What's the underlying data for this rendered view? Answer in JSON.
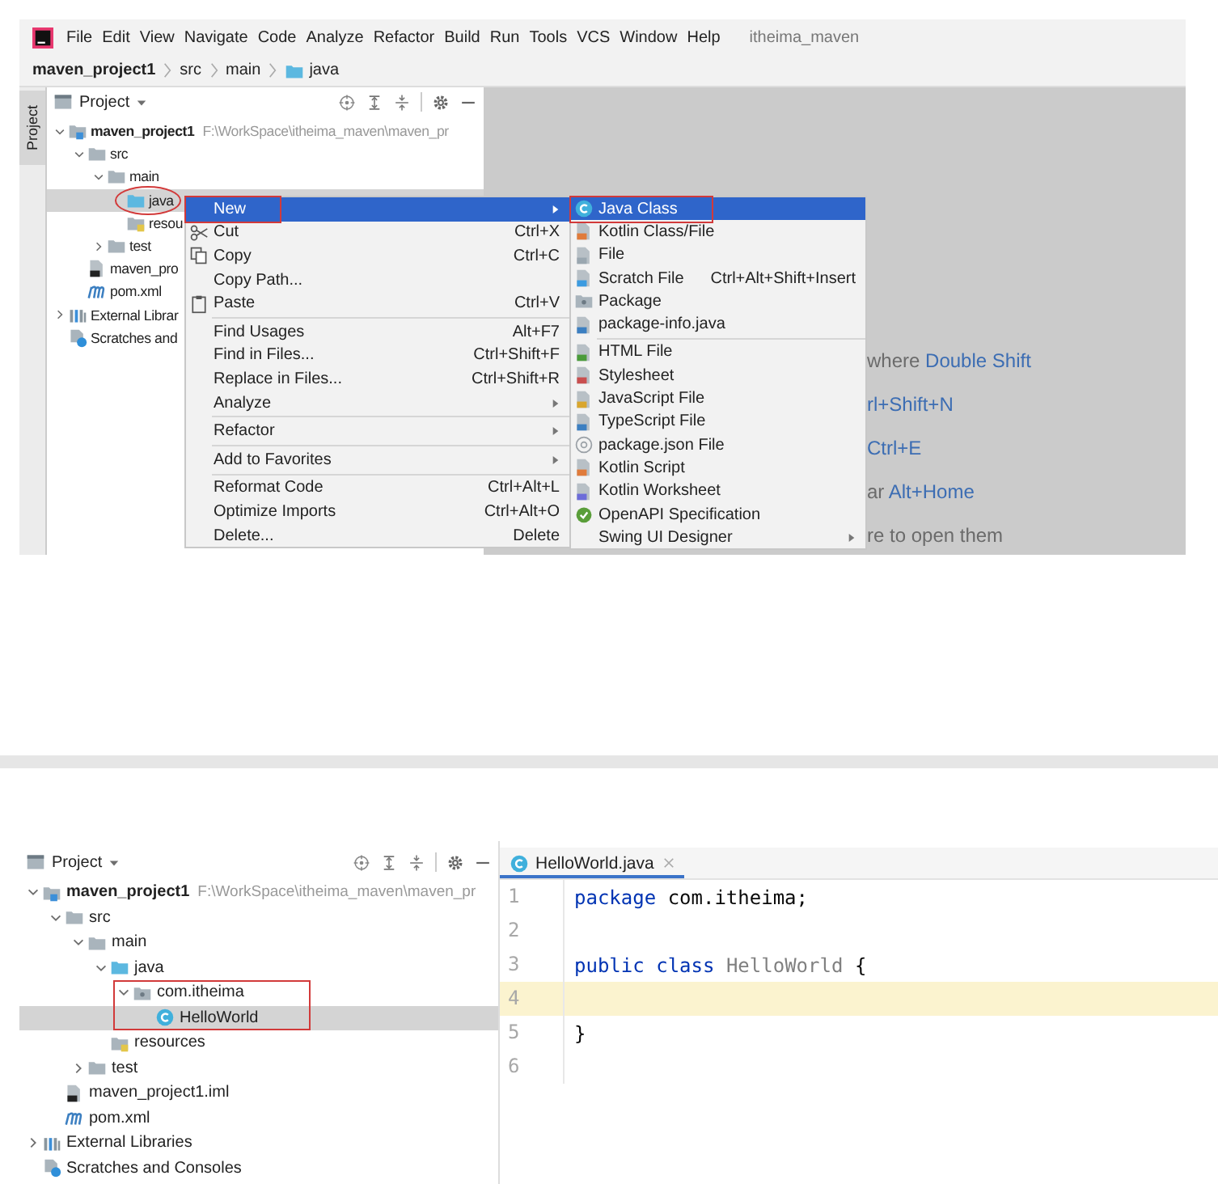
{
  "top_screenshot": {
    "menu_bar": {
      "items": [
        "File",
        "Edit",
        "View",
        "Navigate",
        "Code",
        "Analyze",
        "Refactor",
        "Build",
        "Run",
        "Tools",
        "VCS",
        "Window",
        "Help"
      ],
      "project_title": "itheima_maven"
    },
    "breadcrumbs": [
      {
        "label": "maven_project1",
        "kind": "module"
      },
      {
        "label": "src",
        "kind": "dir"
      },
      {
        "label": "main",
        "kind": "dir"
      },
      {
        "label": "java",
        "kind": "source-folder"
      }
    ],
    "tool_strip": {
      "label": "Project"
    },
    "project_panel": {
      "title": "Project",
      "tree": [
        {
          "label": "maven_project1",
          "kind": "module",
          "path": "F:\\WorkSpace\\itheima_maven\\maven_pr",
          "expanded": true,
          "selected": false,
          "children": [
            {
              "label": "src",
              "kind": "folder",
              "expanded": true,
              "selected": false,
              "children": [
                {
                  "label": "main",
                  "kind": "folder",
                  "expanded": true,
                  "selected": false,
                  "children": [
                    {
                      "label": "java",
                      "kind": "source-folder",
                      "selected": true,
                      "circled": true
                    },
                    {
                      "label": "resou",
                      "kind": "resources-folder",
                      "selected": false
                    }
                  ]
                },
                {
                  "label": "test",
                  "kind": "folder",
                  "expanded": false,
                  "selected": false
                }
              ]
            },
            {
              "label": "maven_pro",
              "kind": "iml-file",
              "selected": false
            },
            {
              "label": "pom.xml",
              "kind": "maven",
              "selected": false
            }
          ]
        },
        {
          "label": "External Librar",
          "kind": "libraries",
          "expanded": false,
          "selected": false
        },
        {
          "label": "Scratches and",
          "kind": "scratches",
          "selected": false
        }
      ]
    },
    "editor_hints": [
      {
        "text": "where",
        "shortcut": "Double Shift"
      },
      {
        "shortcut": "rl+Shift+N"
      },
      {
        "shortcut": "Ctrl+E"
      },
      {
        "text": "ar",
        "shortcut": "Alt+Home"
      },
      {
        "text": "re to open them"
      }
    ],
    "context_menu": {
      "items": [
        {
          "kind": "plain",
          "label": "New",
          "has_submenu": true,
          "selected": true,
          "annotated": true
        },
        {
          "kind": "scissors",
          "label": "Cut",
          "shortcut": "Ctrl+X",
          "selected": false,
          "annotated": false
        },
        {
          "kind": "copy",
          "label": "Copy",
          "shortcut": "Ctrl+C",
          "selected": false,
          "annotated": false
        },
        {
          "kind": "plain",
          "label": "Copy Path...",
          "selected": false,
          "annotated": false
        },
        {
          "kind": "paste",
          "label": "Paste",
          "shortcut": "Ctrl+V",
          "selected": false,
          "annotated": false
        },
        {
          "kind": "separator"
        },
        {
          "kind": "plain",
          "label": "Find Usages",
          "shortcut": "Alt+F7",
          "selected": false,
          "annotated": false
        },
        {
          "kind": "plain",
          "label": "Find in Files...",
          "shortcut": "Ctrl+Shift+F",
          "selected": false,
          "annotated": false
        },
        {
          "kind": "plain",
          "label": "Replace in Files...",
          "shortcut": "Ctrl+Shift+R",
          "selected": false,
          "annotated": false
        },
        {
          "kind": "plain",
          "label": "Analyze",
          "has_submenu": true,
          "selected": false,
          "annotated": false
        },
        {
          "kind": "separator"
        },
        {
          "kind": "plain",
          "label": "Refactor",
          "has_submenu": true,
          "selected": false,
          "annotated": false
        },
        {
          "kind": "separator"
        },
        {
          "kind": "plain",
          "label": "Add to Favorites",
          "has_submenu": true,
          "selected": false,
          "annotated": false
        },
        {
          "kind": "separator"
        },
        {
          "kind": "plain",
          "label": "Reformat Code",
          "shortcut": "Ctrl+Alt+L",
          "selected": false,
          "annotated": false
        },
        {
          "kind": "plain",
          "label": "Optimize Imports",
          "shortcut": "Ctrl+Alt+O",
          "selected": false,
          "annotated": false
        },
        {
          "kind": "plain",
          "label": "Delete...",
          "shortcut": "Delete",
          "selected": false,
          "annotated": false
        }
      ]
    },
    "new_submenu": {
      "items": [
        {
          "kind": "class",
          "label": "Java Class",
          "selected": true,
          "annotated": true
        },
        {
          "kind": "kotlin",
          "label": "Kotlin Class/File",
          "selected": false,
          "annotated": false
        },
        {
          "kind": "file",
          "label": "File",
          "selected": false,
          "annotated": false
        },
        {
          "kind": "scratch",
          "label": "Scratch File",
          "shortcut": "Ctrl+Alt+Shift+Insert",
          "selected": false,
          "annotated": false
        },
        {
          "kind": "package",
          "label": "Package",
          "selected": false,
          "annotated": false
        },
        {
          "kind": "package-info",
          "label": "package-info.java",
          "selected": false,
          "annotated": false
        },
        {
          "kind": "separator"
        },
        {
          "kind": "html",
          "label": "HTML File",
          "selected": false,
          "annotated": false
        },
        {
          "kind": "css",
          "label": "Stylesheet",
          "selected": false,
          "annotated": false
        },
        {
          "kind": "js",
          "label": "JavaScript File",
          "selected": false,
          "annotated": false
        },
        {
          "kind": "ts",
          "label": "TypeScript File",
          "selected": false,
          "annotated": false
        },
        {
          "kind": "json",
          "label": "package.json File",
          "selected": false,
          "annotated": false
        },
        {
          "kind": "kotlin-script",
          "label": "Kotlin Script",
          "selected": false,
          "annotated": false
        },
        {
          "kind": "kotlin-worksheet",
          "label": "Kotlin Worksheet",
          "selected": false,
          "annotated": false
        },
        {
          "kind": "openapi",
          "label": "OpenAPI Specification",
          "selected": false,
          "annotated": false
        },
        {
          "kind": "plain",
          "label": "Swing UI Designer",
          "has_submenu": true,
          "selected": false,
          "annotated": false
        }
      ]
    }
  },
  "bottom_screenshot": {
    "project_panel": {
      "title": "Project",
      "tree": [
        {
          "label": "maven_project1",
          "kind": "module",
          "path": "F:\\WorkSpace\\itheima_maven\\maven_pr",
          "expanded": true,
          "selected": false,
          "children": [
            {
              "label": "src",
              "kind": "folder",
              "expanded": true,
              "selected": false,
              "children": [
                {
                  "label": "main",
                  "kind": "folder",
                  "expanded": true,
                  "selected": false,
                  "children": [
                    {
                      "label": "java",
                      "kind": "source-folder",
                      "expanded": true,
                      "selected": false,
                      "children": [
                        {
                          "label": "com.itheima",
                          "kind": "package",
                          "expanded": true,
                          "selected": false,
                          "boxed": true,
                          "children": [
                            {
                              "label": "HelloWorld",
                              "kind": "class",
                              "selected": true
                            }
                          ]
                        }
                      ]
                    },
                    {
                      "label": "resources",
                      "kind": "resources-folder",
                      "selected": false
                    }
                  ]
                },
                {
                  "label": "test",
                  "kind": "folder",
                  "expanded": false,
                  "selected": false
                }
              ]
            },
            {
              "label": "maven_project1.iml",
              "kind": "iml-file",
              "selected": false
            },
            {
              "label": "pom.xml",
              "kind": "maven",
              "selected": false
            }
          ]
        },
        {
          "label": "External Libraries",
          "kind": "libraries",
          "expanded": false,
          "selected": false
        },
        {
          "label": "Scratches and Consoles",
          "kind": "scratches",
          "selected": false
        }
      ]
    },
    "editor": {
      "tabs": [
        {
          "label": "HelloWorld.java",
          "kind": "class",
          "selected": true
        }
      ],
      "lines": [
        {
          "number": "1",
          "current": false,
          "tokens": [
            {
              "kind": "keyword",
              "text": "package"
            },
            {
              "kind": "plain",
              "text": "com.itheima;"
            }
          ]
        },
        {
          "number": "2",
          "current": false
        },
        {
          "number": "3",
          "current": false,
          "tokens": [
            {
              "kind": "keyword",
              "text": "public"
            },
            {
              "kind": "keyword",
              "text": "class"
            },
            {
              "kind": "unused",
              "text": "HelloWorld"
            },
            {
              "kind": "plain",
              "text": "{"
            }
          ]
        },
        {
          "number": "4",
          "current": true
        },
        {
          "number": "5",
          "current": false,
          "tokens": [
            {
              "kind": "plain",
              "text": "}"
            }
          ]
        },
        {
          "number": "6",
          "current": false
        }
      ]
    }
  }
}
